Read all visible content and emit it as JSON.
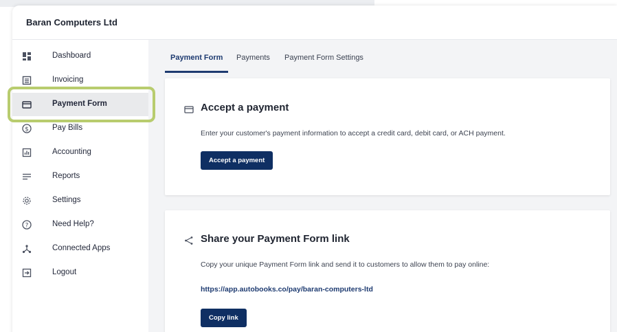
{
  "app": {
    "company_name": "Baran Computers Ltd"
  },
  "sidebar": {
    "items": [
      {
        "label": "Dashboard",
        "icon": "dashboard-icon"
      },
      {
        "label": "Invoicing",
        "icon": "invoice-icon"
      },
      {
        "label": "Payment Form",
        "icon": "credit-card-icon",
        "active": true
      },
      {
        "label": "Pay Bills",
        "icon": "dollar-circle-icon"
      },
      {
        "label": "Accounting",
        "icon": "chart-icon"
      },
      {
        "label": "Reports",
        "icon": "lines-icon"
      },
      {
        "label": "Settings",
        "icon": "gear-icon"
      },
      {
        "label": "Need Help?",
        "icon": "question-icon"
      },
      {
        "label": "Connected Apps",
        "icon": "network-icon"
      },
      {
        "label": "Logout",
        "icon": "logout-icon"
      }
    ]
  },
  "tabs": [
    {
      "label": "Payment Form",
      "active": true
    },
    {
      "label": "Payments"
    },
    {
      "label": "Payment Form Settings"
    }
  ],
  "accept_card": {
    "title": "Accept a payment",
    "description": "Enter your customer's payment information to accept a credit card, debit card, or ACH payment.",
    "button_label": "Accept a payment",
    "icon": "credit-card-icon"
  },
  "share_card": {
    "title": "Share your Payment Form link",
    "description": "Copy your unique Payment Form link and send it to customers to allow them to pay online:",
    "link": "https://app.autobooks.co/pay/baran-computers-ltd",
    "button_label": "Copy link",
    "icon": "share-icon"
  },
  "colors": {
    "primary": "#0f2f63",
    "highlight": "#b8cc6e"
  }
}
